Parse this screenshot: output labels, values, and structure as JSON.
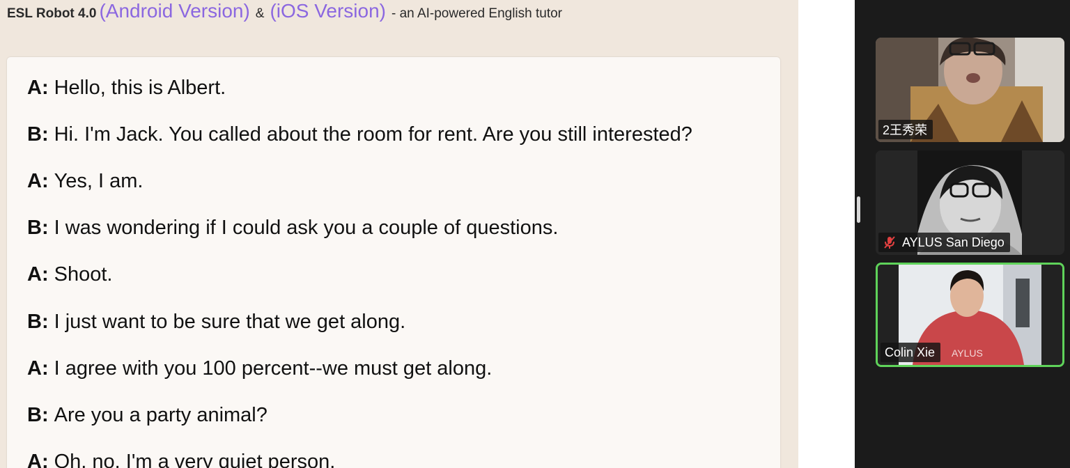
{
  "header": {
    "app_name": "ESL Robot 4.0",
    "android_link": "(Android Version)",
    "ampersand": "&",
    "ios_link": "(iOS Version)",
    "tagline": "- an AI-powered English tutor"
  },
  "dialog": [
    {
      "speaker": "A:",
      "text": "Hello, this is Albert."
    },
    {
      "speaker": "B:",
      "text": "Hi. I'm Jack. You called about the room for rent. Are you still interested?"
    },
    {
      "speaker": "A:",
      "text": "Yes, I am."
    },
    {
      "speaker": "B:",
      "text": "I was wondering if I could ask you a couple of questions."
    },
    {
      "speaker": "A:",
      "text": "Shoot."
    },
    {
      "speaker": "B:",
      "text": "I just want to be sure that we get along."
    },
    {
      "speaker": "A:",
      "text": "I agree with you 100 percent--we must get along."
    },
    {
      "speaker": "B:",
      "text": "Are you a party animal?"
    },
    {
      "speaker": "A:",
      "text": "Oh, no. I'm a very quiet person."
    }
  ],
  "participants": [
    {
      "name": "2王秀荣",
      "muted": false,
      "active_speaker": false
    },
    {
      "name": "AYLUS San Diego",
      "muted": true,
      "active_speaker": false
    },
    {
      "name": "Colin Xie",
      "muted": false,
      "active_speaker": true
    }
  ],
  "colors": {
    "page_bg": "#f0e7dd",
    "card_bg": "#fbf8f5",
    "link": "#8b67e0",
    "meeting_bg": "#1b1b1b",
    "active_border": "#5fd35a",
    "mute_red": "#e04040"
  }
}
